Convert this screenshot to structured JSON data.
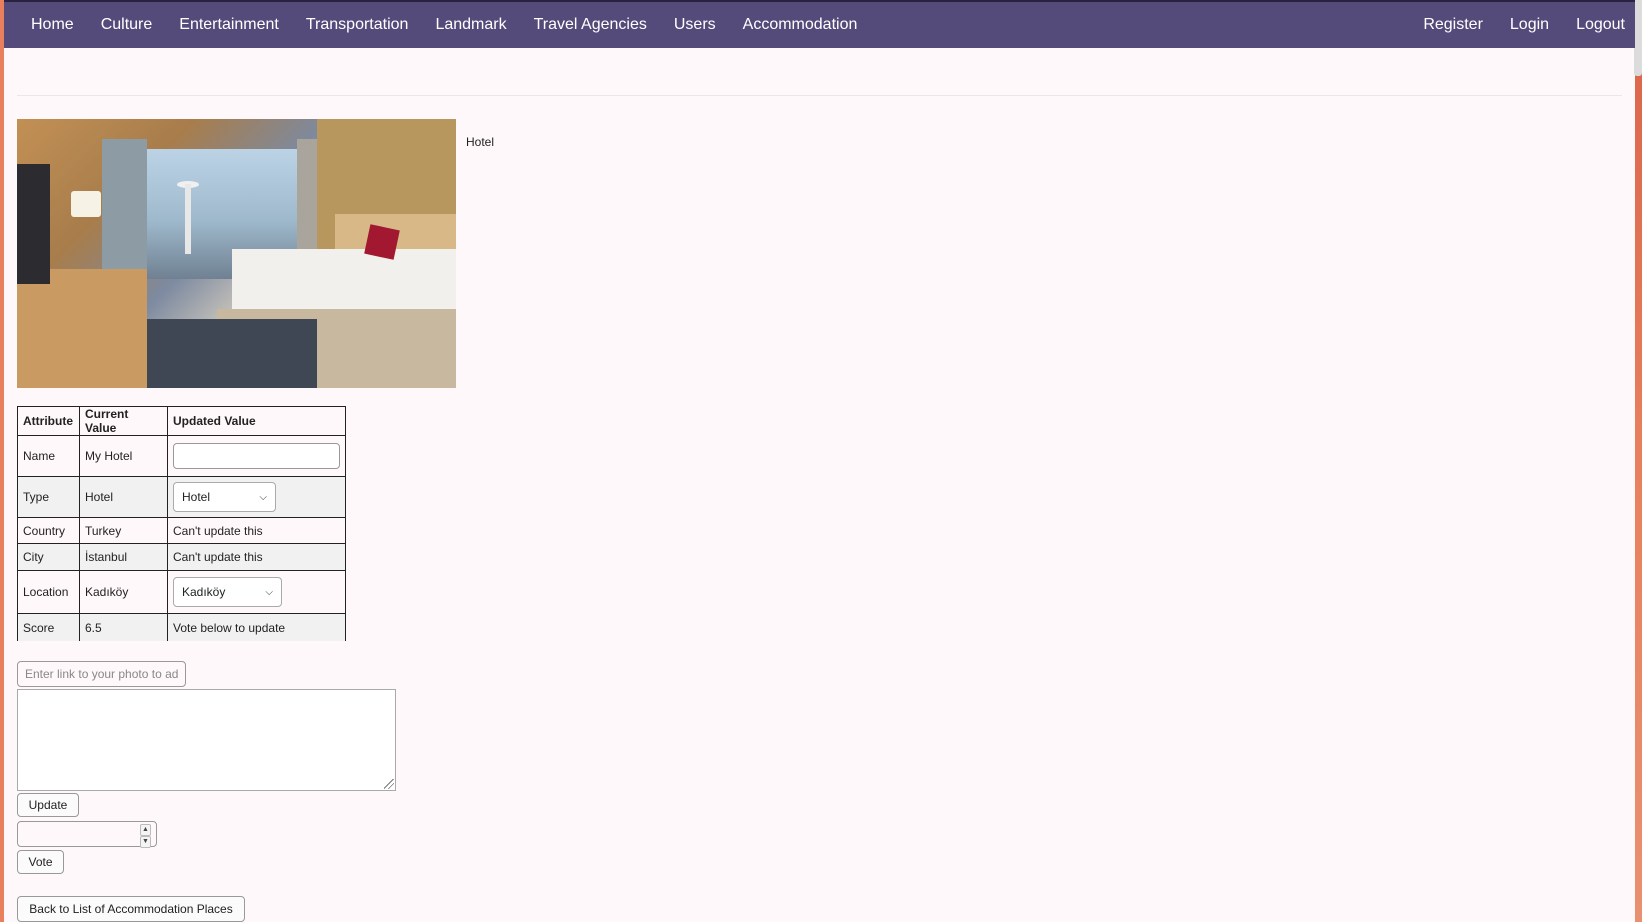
{
  "nav": {
    "left": [
      "Home",
      "Culture",
      "Entertainment",
      "Transportation",
      "Landmark",
      "Travel Agencies",
      "Users",
      "Accommodation"
    ],
    "right": [
      "Register",
      "Login",
      "Logout"
    ]
  },
  "place": {
    "type_caption": "Hotel"
  },
  "table": {
    "headers": {
      "attribute": "Attribute",
      "current": "Current Value",
      "updated": "Updated Value"
    },
    "rows": {
      "name": {
        "label": "Name",
        "current": "My Hotel",
        "input_value": ""
      },
      "type": {
        "label": "Type",
        "current": "Hotel",
        "selected": "Hotel"
      },
      "country": {
        "label": "Country",
        "current": "Turkey",
        "note": "Can't update this"
      },
      "city": {
        "label": "City",
        "current": "İstanbul",
        "note": "Can't update this"
      },
      "location": {
        "label": "Location",
        "current": "Kadıköy",
        "selected": "Kadıköy"
      },
      "score": {
        "label": "Score",
        "current": "6.5",
        "note": "Vote below to update"
      }
    }
  },
  "photo_link": {
    "placeholder": "Enter link to your photo to ad"
  },
  "buttons": {
    "update": "Update",
    "vote": "Vote",
    "back": "Back to List of Accommodation Places"
  },
  "icons": {
    "select_chevron": "chevron-down-icon",
    "spin_up": "chevron-up-icon",
    "spin_down": "chevron-down-icon"
  }
}
